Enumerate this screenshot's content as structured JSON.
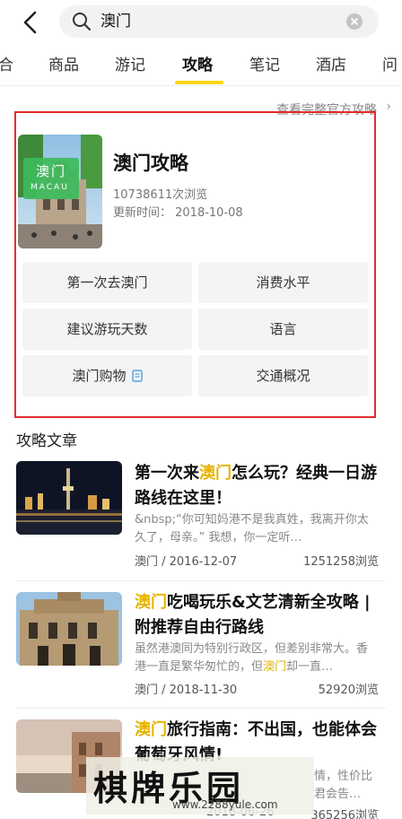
{
  "search": {
    "query": "澳门"
  },
  "tabs": [
    {
      "label": "合"
    },
    {
      "label": "商品"
    },
    {
      "label": "游记"
    },
    {
      "label": "攻略"
    },
    {
      "label": "笔记"
    },
    {
      "label": "酒店"
    },
    {
      "label": "问"
    }
  ],
  "active_tab": "攻略",
  "full_guide_link": "查看完整官方攻略",
  "guide": {
    "thumb_caption_cn": "澳门",
    "thumb_caption_en": "MACAU",
    "title": "澳门攻略",
    "views": "10738611次浏览",
    "updated": "更新时间：  2018-10-08",
    "buttons": [
      {
        "label": "第一次去澳门"
      },
      {
        "label": "消费水平"
      },
      {
        "label": "建议游玩天数"
      },
      {
        "label": "语言"
      },
      {
        "label": "澳门购物"
      },
      {
        "label": "交通概况"
      }
    ]
  },
  "articles_section_title": "攻略文章",
  "articles": [
    {
      "title_pre": "第一次来",
      "title_hl": "澳门",
      "title_post": "怎么玩？经典一日游路线在这里！",
      "snippet_pre": "&nbsp;“你可知妈港不是我真姓，我离开你太久了，母亲。” 我想，你一定听…",
      "snippet_hl": "",
      "snippet_post": "",
      "meta": "澳门 / 2016-12-07",
      "views": "1251258浏览"
    },
    {
      "title_pre": "",
      "title_hl": "澳门",
      "title_post": "吃喝玩乐&文艺清新全攻略 | 附推荐自由行路线",
      "snippet_pre": "虽然港澳同为特别行政区，但差别非常大。香港一直是繁华匆忙的，但",
      "snippet_hl": "澳门",
      "snippet_post": "却一直…",
      "meta": "澳门 / 2018-11-30",
      "views": "52920浏览"
    },
    {
      "title_pre": "",
      "title_hl": "澳门",
      "title_post": "旅行指南：不出国，也能体会葡萄牙风情!",
      "snippet_pre": "情，性价比君会告…",
      "snippet_hl": "",
      "snippet_post": "",
      "meta": "2018-06-26",
      "views": "365256浏览"
    }
  ],
  "watermark": {
    "main": "棋牌乐园",
    "url": "www.2288yule.com"
  },
  "colors": {
    "accent": "#ffd400",
    "highlight": "#e6b400",
    "frame": "#e52b2b"
  }
}
